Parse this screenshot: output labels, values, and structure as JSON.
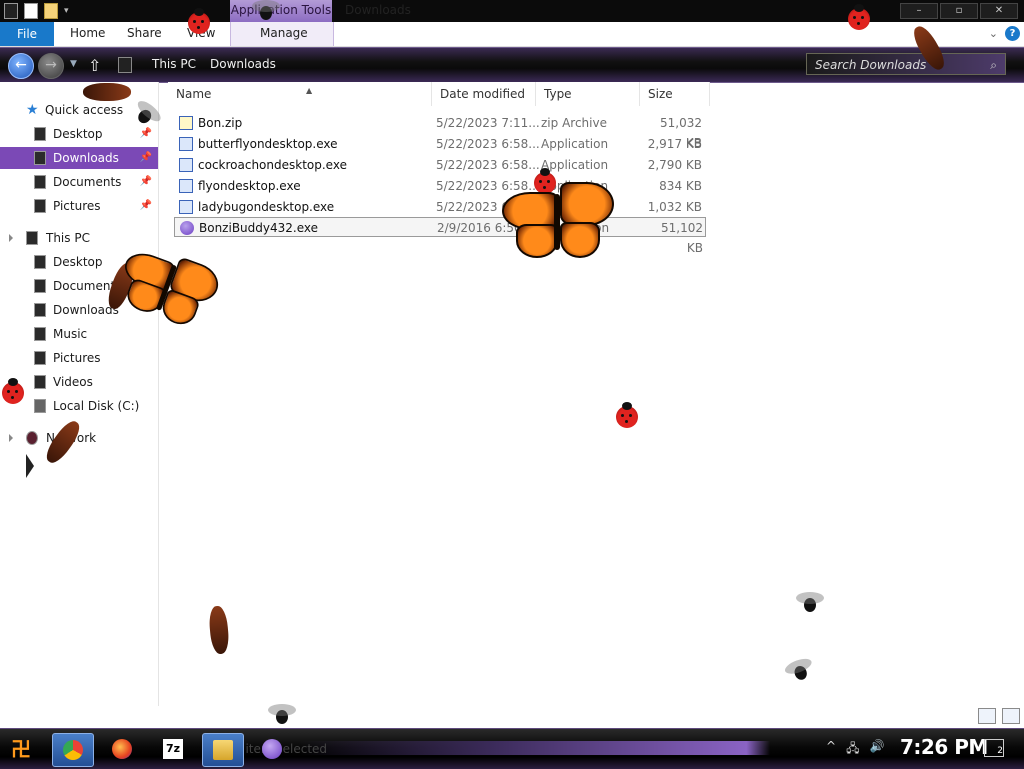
{
  "window": {
    "title": "Downloads",
    "context_tab": "Application Tools"
  },
  "ribbon": {
    "tabs": [
      "File",
      "Home",
      "Share",
      "View",
      "Manage"
    ]
  },
  "address": {
    "breadcrumbs": [
      "This PC",
      "Downloads"
    ],
    "search_placeholder": "Search Downloads"
  },
  "sidebar": {
    "quick_access": {
      "label": "Quick access",
      "items": [
        {
          "label": "Desktop",
          "pinned": true
        },
        {
          "label": "Downloads",
          "pinned": true,
          "selected": true
        },
        {
          "label": "Documents",
          "pinned": true
        },
        {
          "label": "Pictures",
          "pinned": true
        }
      ]
    },
    "this_pc": {
      "label": "This PC",
      "items": [
        {
          "label": "Desktop"
        },
        {
          "label": "Documents"
        },
        {
          "label": "Downloads"
        },
        {
          "label": "Music"
        },
        {
          "label": "Pictures"
        },
        {
          "label": "Videos"
        },
        {
          "label": "Local Disk (C:)"
        }
      ]
    },
    "network": {
      "label": "Network"
    }
  },
  "columns": [
    "Name",
    "Date modified",
    "Type",
    "Size"
  ],
  "files": [
    {
      "name": "Bon.zip",
      "date": "5/22/2023 7:11...",
      "type": "zip Archive",
      "size": "51,032 KB",
      "icon": "zip-icon"
    },
    {
      "name": "butterflyondesktop.exe",
      "date": "5/22/2023 6:58...",
      "type": "Application",
      "size": "2,917 KB",
      "icon": "installer-icon"
    },
    {
      "name": "cockroachondesktop.exe",
      "date": "5/22/2023 6:58...",
      "type": "Application",
      "size": "2,790 KB",
      "icon": "installer-icon"
    },
    {
      "name": "flyondesktop.exe",
      "date": "5/22/2023 6:58...",
      "type": "Application",
      "size": "834 KB",
      "icon": "installer-icon"
    },
    {
      "name": "ladybugondesktop.exe",
      "date": "5/22/2023 6...",
      "type": "Application",
      "size": "1,032 KB",
      "icon": "installer-icon"
    },
    {
      "name": "BonziBuddy432.exe",
      "date": "2/9/2016 6:50 AM",
      "type": "Application",
      "size": "51,102 KB",
      "icon": "bonzi-icon",
      "selected": true
    }
  ],
  "status": {
    "text": "1 item selected"
  },
  "taskbar": {
    "clock": "7:26 PM",
    "notifications": "2",
    "apps": [
      "start-icon",
      "chrome-icon",
      "firefox-icon",
      "7zip-icon",
      "file-explorer-icon",
      "bonzibuddy-icon"
    ]
  },
  "colors": {
    "accent": "#7b49b6",
    "file_tab": "#1979ca",
    "context_tab": "#a48ad0"
  }
}
